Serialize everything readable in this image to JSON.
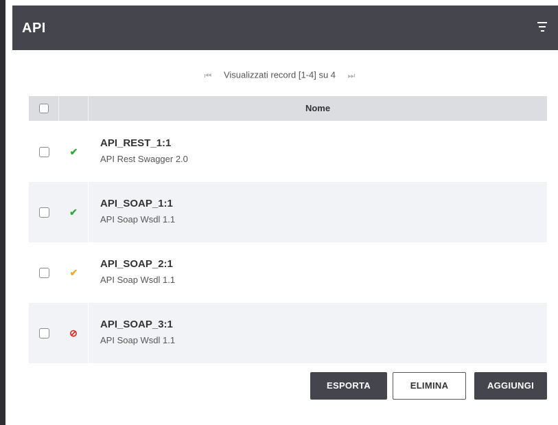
{
  "header": {
    "title": "API",
    "filter_icon": "filter-icon"
  },
  "pager": {
    "text": "Visualizzati record [1-4] su 4",
    "first_glyph": "⏮",
    "last_glyph": "⏭"
  },
  "table": {
    "column_name": "Nome"
  },
  "rows": [
    {
      "title": "API_REST_1:1",
      "subtitle": "API Rest Swagger 2.0",
      "status_glyph": "✔",
      "status_color": "#2eaa3a"
    },
    {
      "title": "API_SOAP_1:1",
      "subtitle": "API Soap Wsdl 1.1",
      "status_glyph": "✔",
      "status_color": "#2eaa3a"
    },
    {
      "title": "API_SOAP_2:1",
      "subtitle": "API Soap Wsdl 1.1",
      "status_glyph": "✔",
      "status_color": "#f5a623"
    },
    {
      "title": "API_SOAP_3:1",
      "subtitle": "API Soap Wsdl 1.1",
      "status_glyph": "⊘",
      "status_color": "#e2231a"
    }
  ],
  "actions": {
    "export_label": "ESPORTA",
    "delete_label": "ELIMINA",
    "add_label": "AGGIUNGI"
  }
}
